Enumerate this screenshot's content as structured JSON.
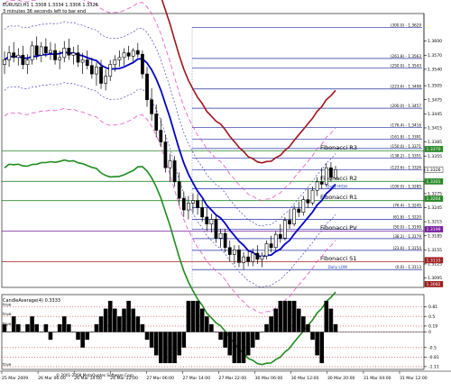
{
  "header": {
    "symbol_line": "EURUSD,H1  1.3308 1.3334 1.3306 1.3326",
    "timer_line": "3 minutes 36 seconds left to bar end"
  },
  "subwindow": {
    "title": "CandleAverage(4) 0.3333"
  },
  "copyright": "© 2001-2008 MetaQuotes Software Corp.",
  "colors": {
    "background": "#ffffff",
    "candle": "#000000",
    "ma": "#0000c8",
    "env_outer": "#a0141e",
    "env_lower": "#1e8c1e",
    "band_dashed_blue": "#4646c8",
    "band_dashed_pink": "#e650c8",
    "fib_line": "#1f2fa0",
    "pivot_line": "#2a8a2a",
    "pivot_pv_line": "#7a1fa0",
    "pivot_s1_line": "#a01f1f",
    "hist_bar": "#000000",
    "grid_dotted": "#c83232"
  },
  "chart_data": [
    {
      "type": "candlestick",
      "symbol": "EURUSD",
      "timeframe": "H1",
      "ylim": [
        1.3075,
        1.3655
      ],
      "price_ticks": [
        "1.3600",
        "1.3570",
        "1.3540",
        "1.3505",
        "1.3475",
        "1.3445",
        "1.3415",
        "1.3385",
        "1.3355",
        "1.3325",
        "1.3300",
        "1.3275",
        "1.3245",
        "1.3215",
        "1.3185",
        "1.3155",
        "1.3125",
        "1.3095"
      ],
      "time_ticks": [
        "25 Mar 2009",
        "26 Mar 06:00",
        "26 Mar 14:00",
        "26 Mar 22:00",
        "27 Mar 06:00",
        "27 Mar 14:00",
        "27 Mar 22:00",
        "30 Mar 06:00",
        "30 Mar 12:00",
        "30 Mar 20:00",
        "31 Mar 04:00",
        "31 Mar 12:00"
      ],
      "fibonacci_levels": [
        {
          "label": "(300.0) - 1.3629",
          "value": 1.3629
        },
        {
          "label": "(261.8) - 1.3563",
          "value": 1.3563
        },
        {
          "label": "(250.0) - 1.3543",
          "value": 1.3543
        },
        {
          "label": "(223.6) - 1.3498",
          "value": 1.3498
        },
        {
          "label": "(200.0) - 1.3457",
          "value": 1.3457
        },
        {
          "label": "(176.4) - 1.3416",
          "value": 1.3416
        },
        {
          "label": "(161.8) - 1.3391",
          "value": 1.3391
        },
        {
          "label": "(150.0) - 1.3371",
          "value": 1.3371
        },
        {
          "label": "(138.2) - 1.3351",
          "value": 1.3351
        },
        {
          "label": "(123.6) - 1.3326",
          "value": 1.3326
        },
        {
          "label": "(100.0) - 1.3285",
          "value": 1.3285
        },
        {
          "label": "(76.4) - 1.3245",
          "value": 1.3245
        },
        {
          "label": "(61.8) - 1.3220",
          "value": 1.322
        },
        {
          "label": "(50.0) - 1.3199",
          "value": 1.3199
        },
        {
          "label": "(38.2) - 1.3179",
          "value": 1.3179
        },
        {
          "label": "(23.6) - 1.3154",
          "value": 1.3154
        },
        {
          "label": "(0.0) - 1.3113",
          "value": 1.3113
        }
      ],
      "daily_labels": [
        {
          "label": "Daily HIGH",
          "value": 1.3285
        },
        {
          "label": "Daily LOW",
          "value": 1.3113
        }
      ],
      "pivots": [
        {
          "name": "Fibonacci R3",
          "value": 1.3366
        },
        {
          "name": "Fibonacci R2",
          "value": 1.3301
        },
        {
          "name": "Fibonacci R1",
          "value": 1.326
        },
        {
          "name": "Fibonacci PV",
          "value": 1.3195
        },
        {
          "name": "Fibonacci S1",
          "value": 1.313
        }
      ],
      "price_badges": [
        {
          "text": "1.3370",
          "value": 1.337,
          "color": "#2a8a2a"
        },
        {
          "text": "1.3326",
          "value": 1.3326,
          "color": "#ffffff",
          "text_color": "#000000"
        },
        {
          "text": "1.3301",
          "value": 1.3301,
          "color": "#2a8a2a"
        },
        {
          "text": "1.3264",
          "value": 1.3264,
          "color": "#2a8a2a"
        },
        {
          "text": "1.3199",
          "value": 1.3199,
          "color": "#7a1fa0"
        },
        {
          "text": "1.3133",
          "value": 1.3133,
          "color": "#a01f1f"
        },
        {
          "text": "1.3082",
          "value": 1.3082,
          "color": "#a01f1f"
        }
      ],
      "candles": [
        {
          "o": 1.355,
          "h": 1.3578,
          "l": 1.353,
          "c": 1.356
        },
        {
          "o": 1.356,
          "h": 1.359,
          "l": 1.3545,
          "c": 1.3575
        },
        {
          "o": 1.3575,
          "h": 1.3598,
          "l": 1.3555,
          "c": 1.3565
        },
        {
          "o": 1.3565,
          "h": 1.3585,
          "l": 1.3548,
          "c": 1.357
        },
        {
          "o": 1.357,
          "h": 1.359,
          "l": 1.354,
          "c": 1.355
        },
        {
          "o": 1.355,
          "h": 1.3572,
          "l": 1.353,
          "c": 1.356
        },
        {
          "o": 1.356,
          "h": 1.36,
          "l": 1.355,
          "c": 1.359
        },
        {
          "o": 1.359,
          "h": 1.361,
          "l": 1.356,
          "c": 1.357
        },
        {
          "o": 1.357,
          "h": 1.3598,
          "l": 1.3555,
          "c": 1.3588
        },
        {
          "o": 1.3588,
          "h": 1.3606,
          "l": 1.3566,
          "c": 1.3575
        },
        {
          "o": 1.3575,
          "h": 1.3598,
          "l": 1.356,
          "c": 1.358
        },
        {
          "o": 1.358,
          "h": 1.3595,
          "l": 1.355,
          "c": 1.356
        },
        {
          "o": 1.356,
          "h": 1.358,
          "l": 1.354,
          "c": 1.3565
        },
        {
          "o": 1.3565,
          "h": 1.36,
          "l": 1.3555,
          "c": 1.3585
        },
        {
          "o": 1.3585,
          "h": 1.3605,
          "l": 1.356,
          "c": 1.357
        },
        {
          "o": 1.357,
          "h": 1.3588,
          "l": 1.355,
          "c": 1.3575
        },
        {
          "o": 1.3575,
          "h": 1.3592,
          "l": 1.3545,
          "c": 1.3555
        },
        {
          "o": 1.3555,
          "h": 1.3575,
          "l": 1.353,
          "c": 1.356
        },
        {
          "o": 1.356,
          "h": 1.358,
          "l": 1.354,
          "c": 1.3548
        },
        {
          "o": 1.3548,
          "h": 1.3565,
          "l": 1.352,
          "c": 1.353
        },
        {
          "o": 1.353,
          "h": 1.3555,
          "l": 1.3505,
          "c": 1.3545
        },
        {
          "o": 1.3545,
          "h": 1.356,
          "l": 1.3498,
          "c": 1.351
        },
        {
          "o": 1.351,
          "h": 1.354,
          "l": 1.3495,
          "c": 1.3525
        },
        {
          "o": 1.3525,
          "h": 1.356,
          "l": 1.3515,
          "c": 1.355
        },
        {
          "o": 1.355,
          "h": 1.357,
          "l": 1.3535,
          "c": 1.356
        },
        {
          "o": 1.356,
          "h": 1.358,
          "l": 1.3545,
          "c": 1.3565
        },
        {
          "o": 1.3565,
          "h": 1.3585,
          "l": 1.3548,
          "c": 1.3575
        },
        {
          "o": 1.3575,
          "h": 1.359,
          "l": 1.356,
          "c": 1.3568
        },
        {
          "o": 1.3568,
          "h": 1.3585,
          "l": 1.3555,
          "c": 1.358
        },
        {
          "o": 1.358,
          "h": 1.3596,
          "l": 1.3565,
          "c": 1.3572
        },
        {
          "o": 1.3572,
          "h": 1.358,
          "l": 1.352,
          "c": 1.353
        },
        {
          "o": 1.353,
          "h": 1.3545,
          "l": 1.346,
          "c": 1.3475
        },
        {
          "o": 1.3475,
          "h": 1.35,
          "l": 1.343,
          "c": 1.3445
        },
        {
          "o": 1.3445,
          "h": 1.3465,
          "l": 1.3395,
          "c": 1.341
        },
        {
          "o": 1.341,
          "h": 1.3435,
          "l": 1.3375,
          "c": 1.3385
        },
        {
          "o": 1.3385,
          "h": 1.34,
          "l": 1.332,
          "c": 1.333
        },
        {
          "o": 1.333,
          "h": 1.336,
          "l": 1.33,
          "c": 1.3345
        },
        {
          "o": 1.3345,
          "h": 1.3355,
          "l": 1.329,
          "c": 1.33
        },
        {
          "o": 1.33,
          "h": 1.332,
          "l": 1.325,
          "c": 1.3265
        },
        {
          "o": 1.3265,
          "h": 1.328,
          "l": 1.3225,
          "c": 1.324
        },
        {
          "o": 1.324,
          "h": 1.327,
          "l": 1.322,
          "c": 1.3255
        },
        {
          "o": 1.3255,
          "h": 1.3275,
          "l": 1.3235,
          "c": 1.326
        },
        {
          "o": 1.326,
          "h": 1.3275,
          "l": 1.323,
          "c": 1.3245
        },
        {
          "o": 1.3245,
          "h": 1.3262,
          "l": 1.3215,
          "c": 1.3225
        },
        {
          "o": 1.3225,
          "h": 1.3245,
          "l": 1.3195,
          "c": 1.321
        },
        {
          "o": 1.321,
          "h": 1.3232,
          "l": 1.3192,
          "c": 1.322
        },
        {
          "o": 1.322,
          "h": 1.323,
          "l": 1.317,
          "c": 1.318
        },
        {
          "o": 1.318,
          "h": 1.32,
          "l": 1.316,
          "c": 1.319
        },
        {
          "o": 1.319,
          "h": 1.32,
          "l": 1.315,
          "c": 1.316
        },
        {
          "o": 1.316,
          "h": 1.3175,
          "l": 1.313,
          "c": 1.3145
        },
        {
          "o": 1.3145,
          "h": 1.3165,
          "l": 1.3125,
          "c": 1.3155
        },
        {
          "o": 1.3155,
          "h": 1.3165,
          "l": 1.3118,
          "c": 1.3128
        },
        {
          "o": 1.3128,
          "h": 1.315,
          "l": 1.3113,
          "c": 1.314
        },
        {
          "o": 1.314,
          "h": 1.3155,
          "l": 1.312,
          "c": 1.313
        },
        {
          "o": 1.313,
          "h": 1.3158,
          "l": 1.312,
          "c": 1.3148
        },
        {
          "o": 1.3148,
          "h": 1.3165,
          "l": 1.3125,
          "c": 1.3135
        },
        {
          "o": 1.3135,
          "h": 1.315,
          "l": 1.3118,
          "c": 1.3142
        },
        {
          "o": 1.3142,
          "h": 1.3175,
          "l": 1.3135,
          "c": 1.3168
        },
        {
          "o": 1.3168,
          "h": 1.3185,
          "l": 1.315,
          "c": 1.316
        },
        {
          "o": 1.316,
          "h": 1.3195,
          "l": 1.3155,
          "c": 1.3188
        },
        {
          "o": 1.3188,
          "h": 1.321,
          "l": 1.317,
          "c": 1.318
        },
        {
          "o": 1.318,
          "h": 1.3225,
          "l": 1.3175,
          "c": 1.3218
        },
        {
          "o": 1.3218,
          "h": 1.324,
          "l": 1.32,
          "c": 1.321
        },
        {
          "o": 1.321,
          "h": 1.325,
          "l": 1.3205,
          "c": 1.3242
        },
        {
          "o": 1.3242,
          "h": 1.3258,
          "l": 1.3225,
          "c": 1.3235
        },
        {
          "o": 1.3235,
          "h": 1.327,
          "l": 1.3228,
          "c": 1.3262
        },
        {
          "o": 1.3262,
          "h": 1.3285,
          "l": 1.3245,
          "c": 1.3255
        },
        {
          "o": 1.3255,
          "h": 1.329,
          "l": 1.325,
          "c": 1.3282
        },
        {
          "o": 1.3282,
          "h": 1.331,
          "l": 1.327,
          "c": 1.33
        },
        {
          "o": 1.33,
          "h": 1.333,
          "l": 1.3285,
          "c": 1.3295
        },
        {
          "o": 1.3295,
          "h": 1.334,
          "l": 1.329,
          "c": 1.333
        },
        {
          "o": 1.333,
          "h": 1.3342,
          "l": 1.33,
          "c": 1.331
        },
        {
          "o": 1.3308,
          "h": 1.3334,
          "l": 1.3306,
          "c": 1.3326
        }
      ]
    },
    {
      "type": "bar",
      "name": "CandleAverage(4)",
      "ylim": [
        -1.2,
        1.2
      ],
      "value_ticks": [
        "0.81",
        "0.5",
        "0.19",
        "0",
        "-0.5",
        "-0.81",
        "-1.11"
      ],
      "level_labels": [
        "true",
        "true",
        "true",
        "true"
      ],
      "values": [
        0.25,
        0.0,
        0.5,
        0.25,
        0.0,
        0.25,
        0.5,
        0.25,
        0.0,
        0.25,
        -0.25,
        0.0,
        0.25,
        0.5,
        0.25,
        0.0,
        -0.25,
        -0.5,
        -0.25,
        0.0,
        0.25,
        0.5,
        0.75,
        1.0,
        0.75,
        0.5,
        0.75,
        1.0,
        0.75,
        0.5,
        0.25,
        -0.25,
        -0.5,
        -0.75,
        -1.0,
        -1.0,
        -1.0,
        -1.0,
        -0.75,
        -0.5,
        1.0,
        1.0,
        1.0,
        0.75,
        0.5,
        0.25,
        0.0,
        -0.25,
        -0.5,
        -0.75,
        -1.0,
        -1.0,
        -1.0,
        -0.75,
        -0.5,
        -0.25,
        0.0,
        0.25,
        0.5,
        0.75,
        1.0,
        1.0,
        1.0,
        1.0,
        0.75,
        0.5,
        0.25,
        -0.25,
        -0.75,
        -1.0,
        1.0,
        0.75,
        0.25
      ]
    }
  ]
}
